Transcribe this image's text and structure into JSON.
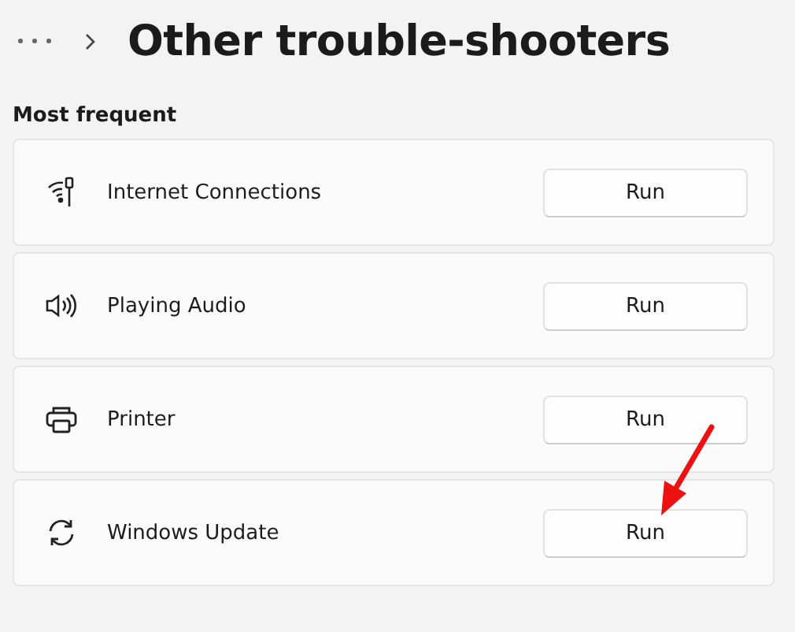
{
  "header": {
    "title": "Other trouble-shooters"
  },
  "section": {
    "heading": "Most frequent"
  },
  "troubleshooters": [
    {
      "kind": "network",
      "label": "Internet Connections",
      "button": "Run"
    },
    {
      "kind": "audio",
      "label": "Playing Audio",
      "button": "Run"
    },
    {
      "kind": "printer",
      "label": "Printer",
      "button": "Run"
    },
    {
      "kind": "update",
      "label": "Windows Update",
      "button": "Run"
    }
  ],
  "annotation": {
    "kind": "arrow",
    "color": "#ee1111"
  }
}
